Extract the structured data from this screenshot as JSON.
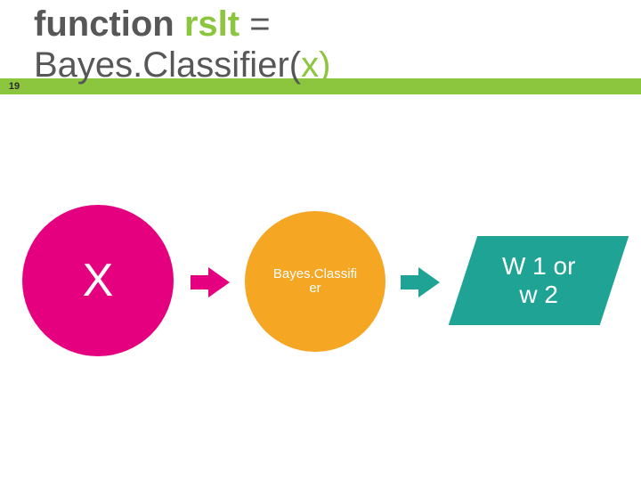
{
  "slide_number": "19",
  "title": {
    "keyword": "function",
    "result_name": "rslt",
    "equals": "=",
    "class_name": "Bayes.Classifier",
    "paren_open": "(",
    "arg": "x",
    "paren_close": ")"
  },
  "diagram": {
    "input_label": "X",
    "classifier_label_line1": "Bayes.Classifi",
    "classifier_label_line2": "er",
    "output_label_line1": "W 1 or",
    "output_label_line2": "w 2"
  },
  "colors": {
    "green": "#8cc63f",
    "magenta": "#e4007f",
    "orange": "#f5a623",
    "teal": "#1fa394"
  }
}
